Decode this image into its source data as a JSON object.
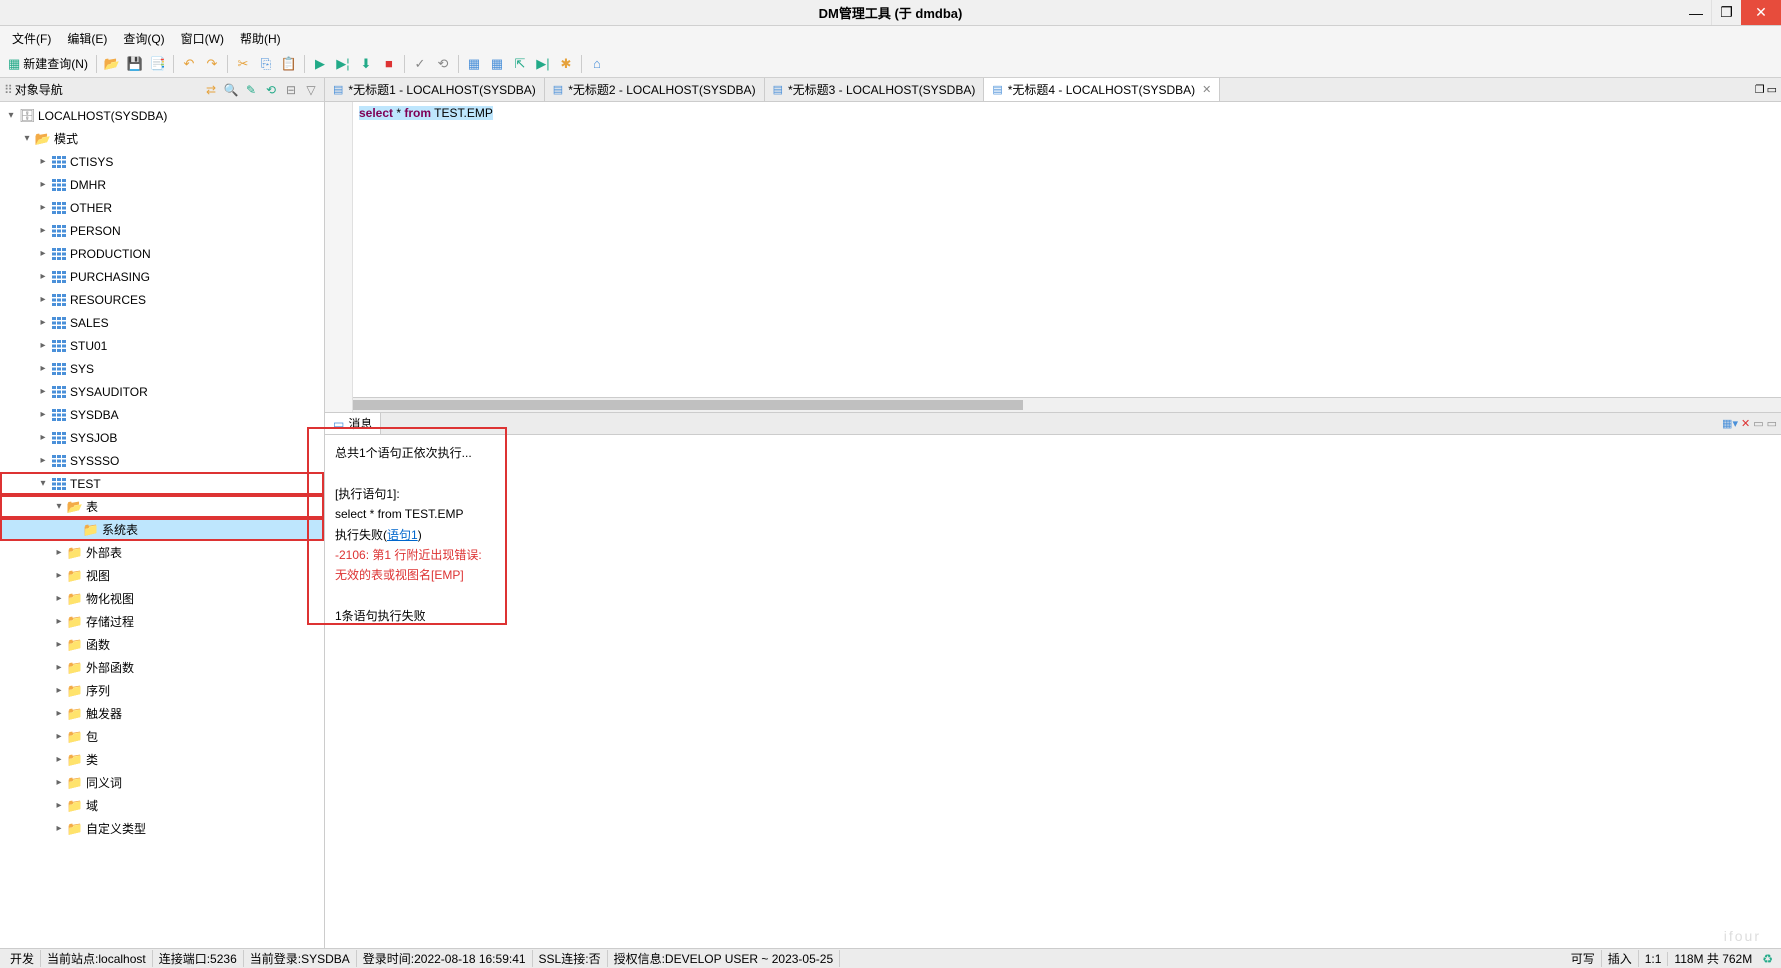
{
  "window": {
    "title": "DM管理工具 (于 dmdba)"
  },
  "menu": {
    "file": "文件(F)",
    "edit": "编辑(E)",
    "query": "查询(Q)",
    "window": "窗口(W)",
    "help": "帮助(H)"
  },
  "toolbar": {
    "new_query": "新建查询(N)"
  },
  "sidebar": {
    "title": "对象导航",
    "root": "LOCALHOST(SYSDBA)",
    "mode": "模式",
    "schemas": [
      "CTISYS",
      "DMHR",
      "OTHER",
      "PERSON",
      "PRODUCTION",
      "PURCHASING",
      "RESOURCES",
      "SALES",
      "STU01",
      "SYS",
      "SYSAUDITOR",
      "SYSDBA",
      "SYSJOB",
      "SYSSSO",
      "TEST"
    ],
    "test_children": {
      "table": "表",
      "systable": "系统表",
      "exttable": "外部表",
      "view": "视图",
      "matview": "物化视图",
      "proc": "存储过程",
      "func": "函数",
      "extfunc": "外部函数",
      "seq": "序列",
      "trigger": "触发器",
      "pkg": "包",
      "class": "类",
      "synonym": "同义词",
      "domain": "域",
      "custom": "自定义类型"
    }
  },
  "tabs": {
    "tab1": "*无标题1 - LOCALHOST(SYSDBA)",
    "tab2": "*无标题2 - LOCALHOST(SYSDBA)",
    "tab3": "*无标题3 - LOCALHOST(SYSDBA)",
    "tab4": "*无标题4 - LOCALHOST(SYSDBA)"
  },
  "editor": {
    "sql_kw1": "select",
    "sql_mid": " * ",
    "sql_kw2": "from",
    "sql_tail": " TEST.EMP"
  },
  "message": {
    "tab": "消息",
    "line1": "总共1个语句正依次执行...",
    "line2": "[执行语句1]:",
    "line3": "select * from TEST.EMP",
    "line4a": "执行失败(",
    "line4b": "语句1",
    "line4c": ")",
    "err1": "-2106: 第1 行附近出现错误:",
    "err2": "无效的表或视图名[EMP]",
    "line5": "1条语句执行失败"
  },
  "status": {
    "dev": "开发",
    "site": "当前站点:localhost",
    "port": "连接端口:5236",
    "login": "当前登录:SYSDBA",
    "logintime": "登录时间:2022-08-18 16:59:41",
    "ssl": "SSL连接:否",
    "auth": "授权信息:DEVELOP USER ~ 2023-05-25",
    "writable": "可写",
    "insert": "插入",
    "pos": "1:1",
    "mem": "118M 共 762M"
  },
  "watermark": "ifour"
}
